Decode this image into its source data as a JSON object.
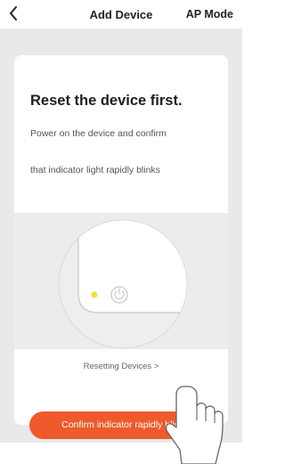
{
  "header": {
    "back_icon": "chevron-left-icon",
    "title": "Add Device",
    "mode_label": "AP Mode"
  },
  "card": {
    "heading": "Reset the device first.",
    "instruction_line1": "Power on the device and confirm",
    "instruction_line2": "that indicator light rapidly blinks",
    "illustration_icon": "device-power-icon",
    "indicator_color": "#f0e23c",
    "reset_link": "Resetting Devices >"
  },
  "confirm_button": {
    "label": "Confirm indicator rapidly blink",
    "color": "#ee5a2c"
  },
  "overlay": {
    "hand_icon": "pointing-hand-icon"
  }
}
